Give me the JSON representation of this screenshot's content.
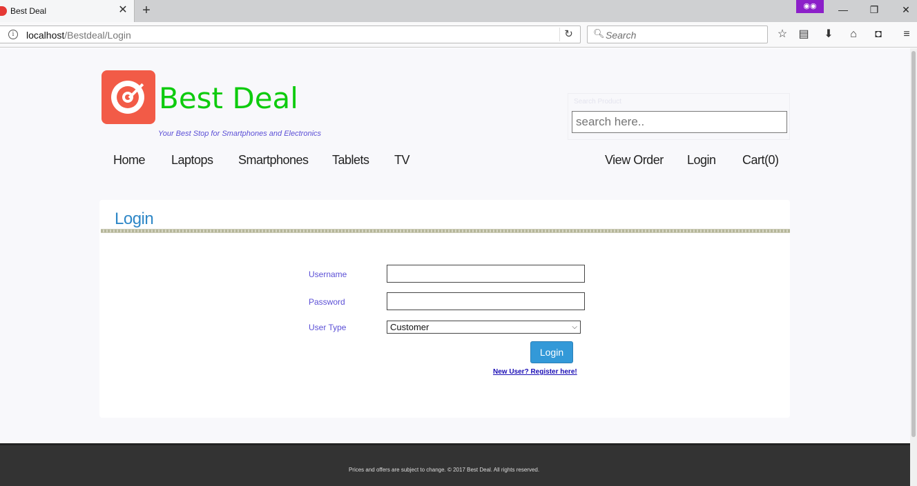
{
  "browser": {
    "tab_title": "Best Deal",
    "tab_close": "✕",
    "new_tab": "+",
    "url_host": "localhost",
    "url_path": "/Bestdeal/Login",
    "search_placeholder": "Search",
    "icons": [
      "info-icon",
      "reload-icon",
      "search-icon",
      "bookmark-star-icon",
      "reader-icon",
      "download-icon",
      "home-icon",
      "pocket-icon",
      "menu-icon",
      "private-mask-icon",
      "minimize-icon",
      "restore-icon",
      "close-icon"
    ]
  },
  "site": {
    "title": "Best Deal",
    "tagline": "Your Best Stop for Smartphones and Electronics",
    "search_caption": "Search Product",
    "search_placeholder": "search here..",
    "brand_color": "#0ecb0e"
  },
  "menu": {
    "left": [
      {
        "label": "Home"
      },
      {
        "label": "Laptops"
      },
      {
        "label": "Smartphones"
      },
      {
        "label": "Tablets"
      },
      {
        "label": "TV"
      }
    ],
    "right": [
      {
        "label": "View Order"
      },
      {
        "label": "Login"
      },
      {
        "label": "Cart(0)"
      }
    ]
  },
  "login": {
    "heading": "Login",
    "username_label": "Username",
    "username_value": "",
    "password_label": "Password",
    "password_value": "",
    "usertype_label": "User Type",
    "usertype_selected": "Customer",
    "submit_label": "Login",
    "register_link": "New User? Register here!"
  },
  "footer": {
    "text": "Prices and offers are subject to change. © 2017 Best Deal. All rights reserved."
  }
}
